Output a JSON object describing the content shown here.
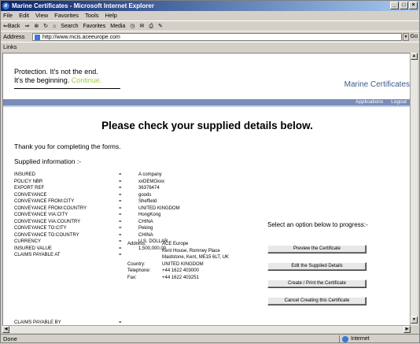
{
  "window": {
    "title": "Marine Certificates - Microsoft Internet Explorer",
    "btn_min": "_",
    "btn_max": "□",
    "btn_close": "×"
  },
  "menu": [
    "File",
    "Edit",
    "View",
    "Favorites",
    "Tools",
    "Help"
  ],
  "toolbar": {
    "back": "⇐Back",
    "forward": "⇒",
    "stop": "⊗",
    "refresh": "↻",
    "home": "⌂",
    "search": "Search",
    "favorites": "Favorites",
    "media": "Media",
    "history": "◷",
    "mail": "✉",
    "print": "⎙",
    "edit": "✎"
  },
  "address": {
    "label": "Address",
    "url": "http://www.mcis.aceeurope.com",
    "go_label": "Go"
  },
  "links_label": "Links",
  "status": {
    "left": "Done",
    "zone": "Internet"
  },
  "page": {
    "tagline_line1": "Protection. It's not the end.",
    "tagline_line2": "It's the beginning.",
    "tagline_continue": "Continue.",
    "brand": "Marine Certificates",
    "nav": [
      "Applications",
      "Logout"
    ],
    "heading": "Please check your supplied details below.",
    "thanks": "Thank you for completing the forms.",
    "supplied_heading": "Supplied information :-",
    "equals": "=",
    "details": [
      {
        "label": "INSURED",
        "value": "A company"
      },
      {
        "label": "POLICY NBR",
        "value": "xxDEMOxxx"
      },
      {
        "label": "EXPORT REF",
        "value": "36376474"
      },
      {
        "label": "CONVEYANCE",
        "value": "goods"
      },
      {
        "label": "CONVEYANCE FROM:CITY",
        "value": "Sheffield"
      },
      {
        "label": "CONVEYANCE FROM:COUNTRY",
        "value": "UNITED KINGDOM"
      },
      {
        "label": "CONVEYANCE VIA:CITY",
        "value": "HongKong"
      },
      {
        "label": "CONVEYANCE VIA:COUNTRY",
        "value": "CHINA"
      },
      {
        "label": "CONVEYANCE TO:CITY",
        "value": "Peking"
      },
      {
        "label": "CONVEYANCE TO:COUNTRY",
        "value": "CHINA"
      },
      {
        "label": "CURRENCY",
        "value": "U.S. DOLLAR"
      },
      {
        "label": "INSURED VALUE",
        "value": "1,500,000.00"
      },
      {
        "label": "CLAIMS PAYABLE AT",
        "value": ""
      }
    ],
    "claims_address": {
      "address_label": "Address:",
      "address_lines": [
        "ACE Europe",
        "Kent House, Romney Place",
        "Maidstone, Kent, ME15 6LT, UK"
      ],
      "country_label": "Country:",
      "country": "UNITED KINGDOM",
      "telephone_label": "Telephone:",
      "telephone": "+44 1622 403000",
      "fax_label": "Fax:",
      "fax": "+44 1622 403251"
    },
    "claims_payable_by_label": "CLAIMS PAYABLE BY",
    "progress_text": "Select an option below to progress:-",
    "actions": [
      "Preview the Certificate",
      "Edit the Supplied Details",
      "Create / Print the Certificate",
      "Cancel Creating this Certificate"
    ]
  }
}
